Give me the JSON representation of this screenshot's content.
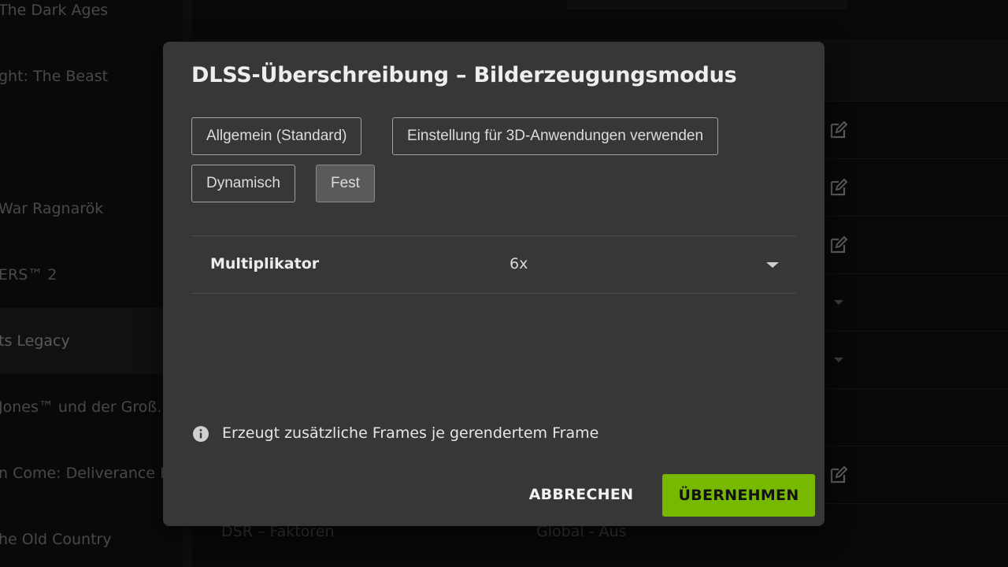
{
  "sidebar": {
    "items": [
      {
        "label": "The Dark Ages",
        "selected": false
      },
      {
        "label": "ght: The Beast",
        "selected": false
      },
      {
        "label": "",
        "selected": false
      },
      {
        "label": "War Ragnarök",
        "selected": false
      },
      {
        "label": "ERS™ 2",
        "selected": false
      },
      {
        "label": "ts Legacy",
        "selected": true
      },
      {
        "label": "Jones™ und der Groß…",
        "selected": false
      },
      {
        "label": "n Come: Deliverance II",
        "selected": false
      },
      {
        "label": "he Old Country",
        "selected": false
      }
    ]
  },
  "background_settings": {
    "row_label": "DSR – Faktoren",
    "row_value": "Global - Aus"
  },
  "dialog": {
    "title": "DLSS-Überschreibung – Bilderzeugungsmodus",
    "options": [
      {
        "label": "Allgemein (Standard)",
        "active": false
      },
      {
        "label": "Einstellung für 3D-Anwendungen verwenden",
        "active": false
      },
      {
        "label": "Dynamisch",
        "active": false
      },
      {
        "label": "Fest",
        "active": true
      }
    ],
    "multiplier": {
      "label": "Multiplikator",
      "value": "6x"
    },
    "info_text": "Erzeugt zusätzliche Frames je gerendertem Frame",
    "cancel_label": "ABBRECHEN",
    "apply_label": "ÜBERNEHMEN"
  },
  "colors": {
    "accent": "#76b900",
    "dialog_bg": "#373737",
    "page_bg": "#0c0c0c"
  },
  "icons": {
    "row_action": "edit-icon",
    "row_dropdown": "chevron-down-icon",
    "info": "info-icon",
    "select_caret": "caret-down-icon"
  }
}
